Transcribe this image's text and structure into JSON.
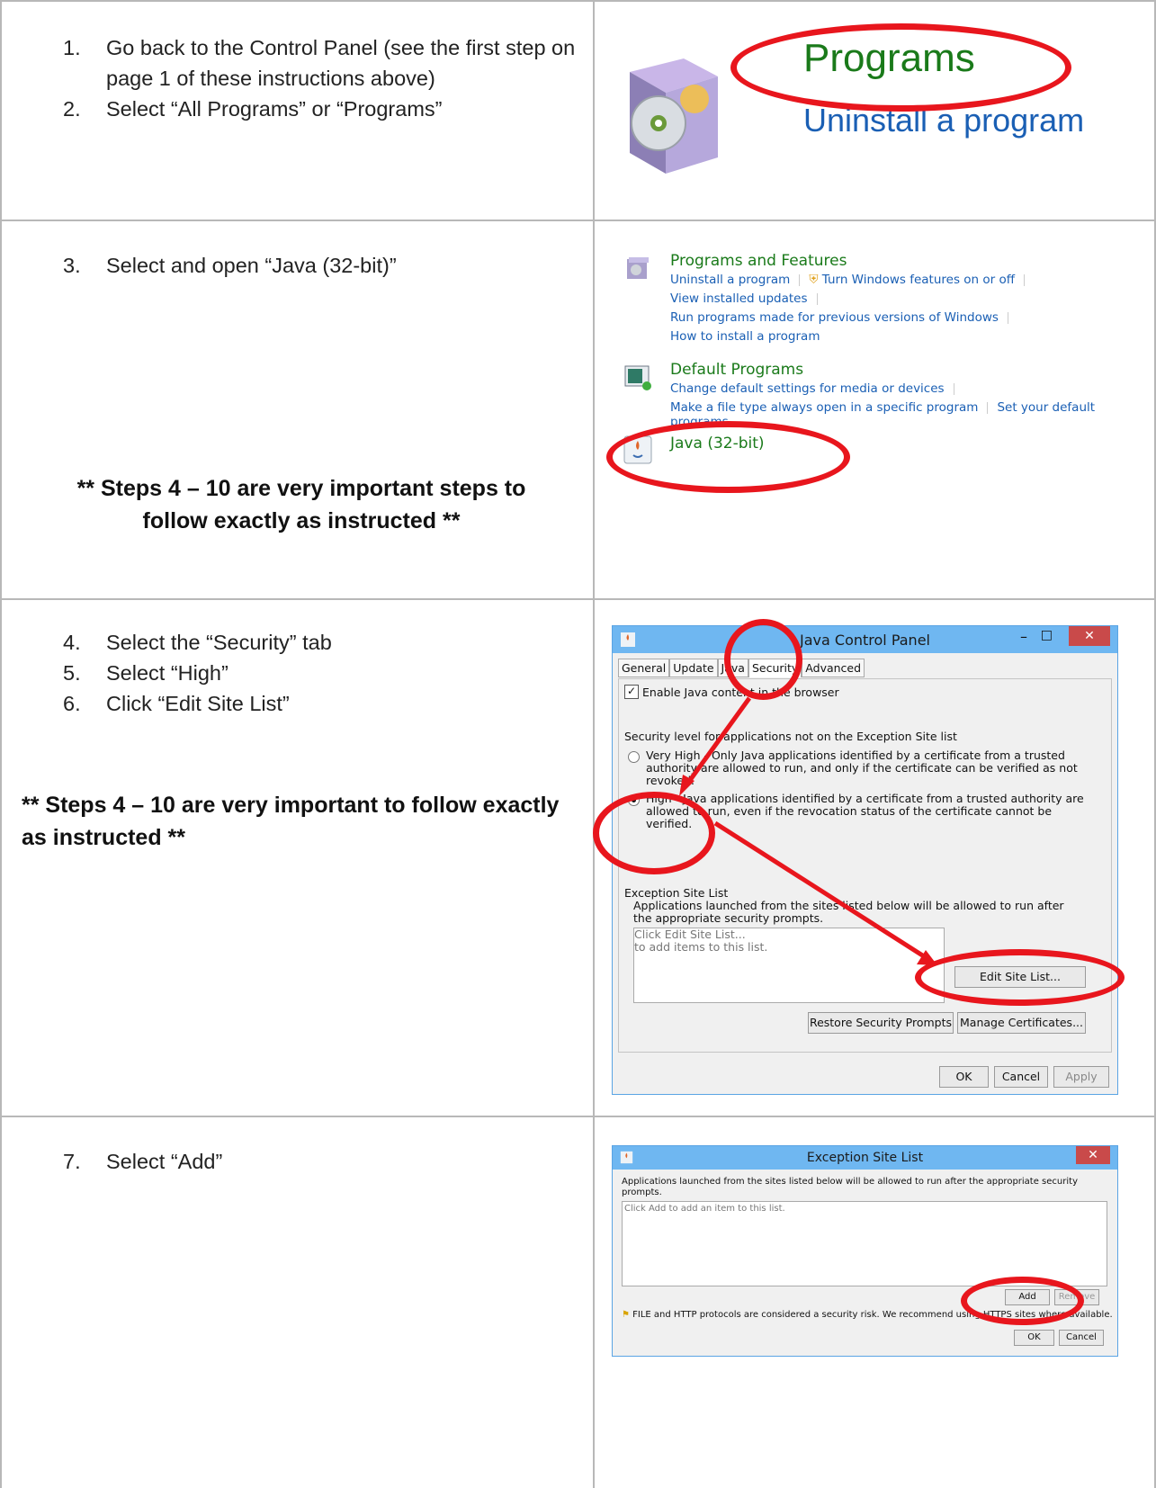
{
  "row1": {
    "steps": [
      {
        "num": "1.",
        "text": "Go back to the Control Panel (see the first step on page 1 of these instructions above)"
      },
      {
        "num": "2.",
        "text": " Select “All Programs” or “Programs”"
      }
    ],
    "programs_title": "Programs",
    "programs_link": "Uninstall a program"
  },
  "row2": {
    "step": {
      "num": "3.",
      "text": "Select and open “Java (32-bit)”"
    },
    "note": "** Steps 4 – 10 are very important steps to follow exactly as instructed **",
    "control_panel": {
      "programs_features": {
        "title": "Programs and Features",
        "links": [
          "Uninstall a program",
          "Turn Windows features on or off",
          "View installed updates",
          "Run programs made for previous versions of Windows",
          "How to install a program"
        ]
      },
      "default_programs": {
        "title": "Default Programs",
        "links": [
          "Change default settings for media or devices",
          "Make a file type always open in a specific program",
          "Set your default programs"
        ]
      },
      "java": {
        "title": "Java (32-bit)"
      }
    }
  },
  "row3": {
    "steps": [
      {
        "num": "4.",
        "text": "Select the “Security” tab"
      },
      {
        "num": "5.",
        "text": "Select “High”"
      },
      {
        "num": "6.",
        "text": "Click “Edit Site List”"
      }
    ],
    "note": "** Steps 4 – 10 are very important to follow exactly as instructed **",
    "dialog": {
      "title": "Java Control Panel",
      "tabs": [
        "General",
        "Update",
        "Java",
        "Security",
        "Advanced"
      ],
      "active_tab": "Security",
      "enable_checkbox": "Enable Java content in the browser",
      "security_label": "Security level for applications not on the Exception Site list",
      "option_very_high": "Very High - Only Java applications identified by a certificate from a trusted authority are allowed to run, and only if the certificate can be verified as not revoked.",
      "option_high": "High - Java applications identified by a certificate from a trusted authority are allowed to run, even if the revocation status of the certificate cannot be verified.",
      "exception_label": "Exception Site List",
      "exception_desc": "Applications launched from the sites listed below will be allowed to run after the appropriate security prompts.",
      "list_placeholder_1": "Click Edit Site List...",
      "list_placeholder_2": "to add items to this list.",
      "edit_button": "Edit Site List...",
      "restore_button": "Restore Security Prompts",
      "manage_button": "Manage Certificates...",
      "ok": "OK",
      "cancel": "Cancel",
      "apply": "Apply"
    }
  },
  "row4": {
    "step": {
      "num": "7.",
      "text": "Select “Add”"
    },
    "dialog": {
      "title": "Exception Site List",
      "desc": "Applications launched from the sites listed below will be allowed to run after the appropriate security prompts.",
      "placeholder": "Click Add to add an item to this list.",
      "add": "Add",
      "remove": "Remove",
      "warning": "FILE and HTTP protocols are considered a security risk.  We recommend using HTTPS sites where available.",
      "ok": "OK",
      "cancel": "Cancel"
    }
  }
}
